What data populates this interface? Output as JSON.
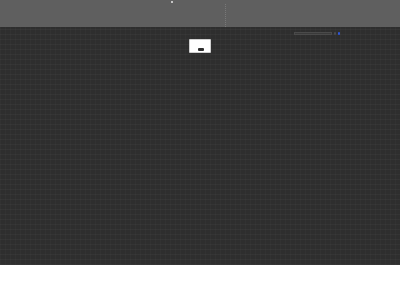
{
  "window": {
    "title": ""
  },
  "labels": {
    "left_small": "",
    "top_small": "",
    "dialog_text": "",
    "dialog_button": ""
  },
  "toolbar": {
    "search_placeholder": "",
    "button_label": "",
    "link_label": ""
  },
  "colors": {
    "top_chrome": "#5f5f5f",
    "main_background": "#2e2e2e",
    "bottom_background": "#ffffff",
    "dialog_background": "#ffffff",
    "accent_blue": "#2f57d9"
  },
  "icons": {
    "app": "app-icon"
  }
}
